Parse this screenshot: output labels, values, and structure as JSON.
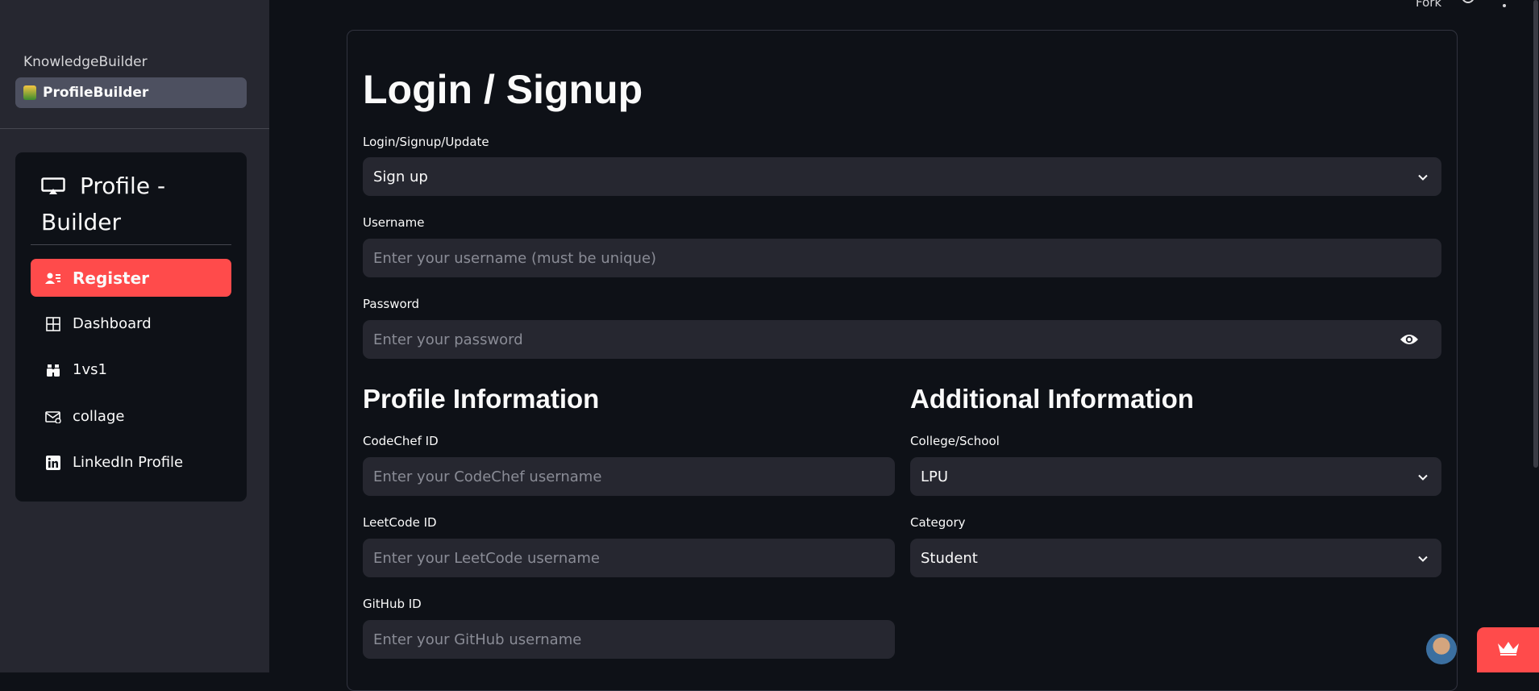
{
  "sidebar": {
    "pages": [
      {
        "label": "KnowledgeBuilder",
        "active": false
      },
      {
        "label": "ProfileBuilder",
        "active": true
      }
    ],
    "menu": {
      "title": "Profile - Builder",
      "items": [
        {
          "label": "Register",
          "icon": "person-lines-icon",
          "active": true
        },
        {
          "label": "Dashboard",
          "icon": "grid-icon",
          "active": false
        },
        {
          "label": "1vs1",
          "icon": "binoculars-icon",
          "active": false
        },
        {
          "label": "collage",
          "icon": "envelope-icon",
          "active": false
        },
        {
          "label": "LinkedIn Profile",
          "icon": "linkedin-icon",
          "active": false
        }
      ]
    }
  },
  "header": {
    "fork_label": "Fork"
  },
  "form": {
    "title": "Login / Signup",
    "mode": {
      "label": "Login/Signup/Update",
      "value": "Sign up"
    },
    "username": {
      "label": "Username",
      "placeholder": "Enter your username (must be unique)"
    },
    "password": {
      "label": "Password",
      "placeholder": "Enter your password"
    },
    "profile_section": {
      "title": "Profile Information",
      "codechef": {
        "label": "CodeChef ID",
        "placeholder": "Enter your CodeChef username"
      },
      "leetcode": {
        "label": "LeetCode ID",
        "placeholder": "Enter your LeetCode username"
      },
      "github": {
        "label": "GitHub ID",
        "placeholder": "Enter your GitHub username"
      }
    },
    "additional_section": {
      "title": "Additional Information",
      "college": {
        "label": "College/School",
        "value": "LPU"
      },
      "category": {
        "label": "Category",
        "value": "Student"
      }
    }
  },
  "colors": {
    "accent": "#ff4b4b",
    "background": "#0e1117",
    "sidebar": "#262730",
    "input": "#262730"
  }
}
